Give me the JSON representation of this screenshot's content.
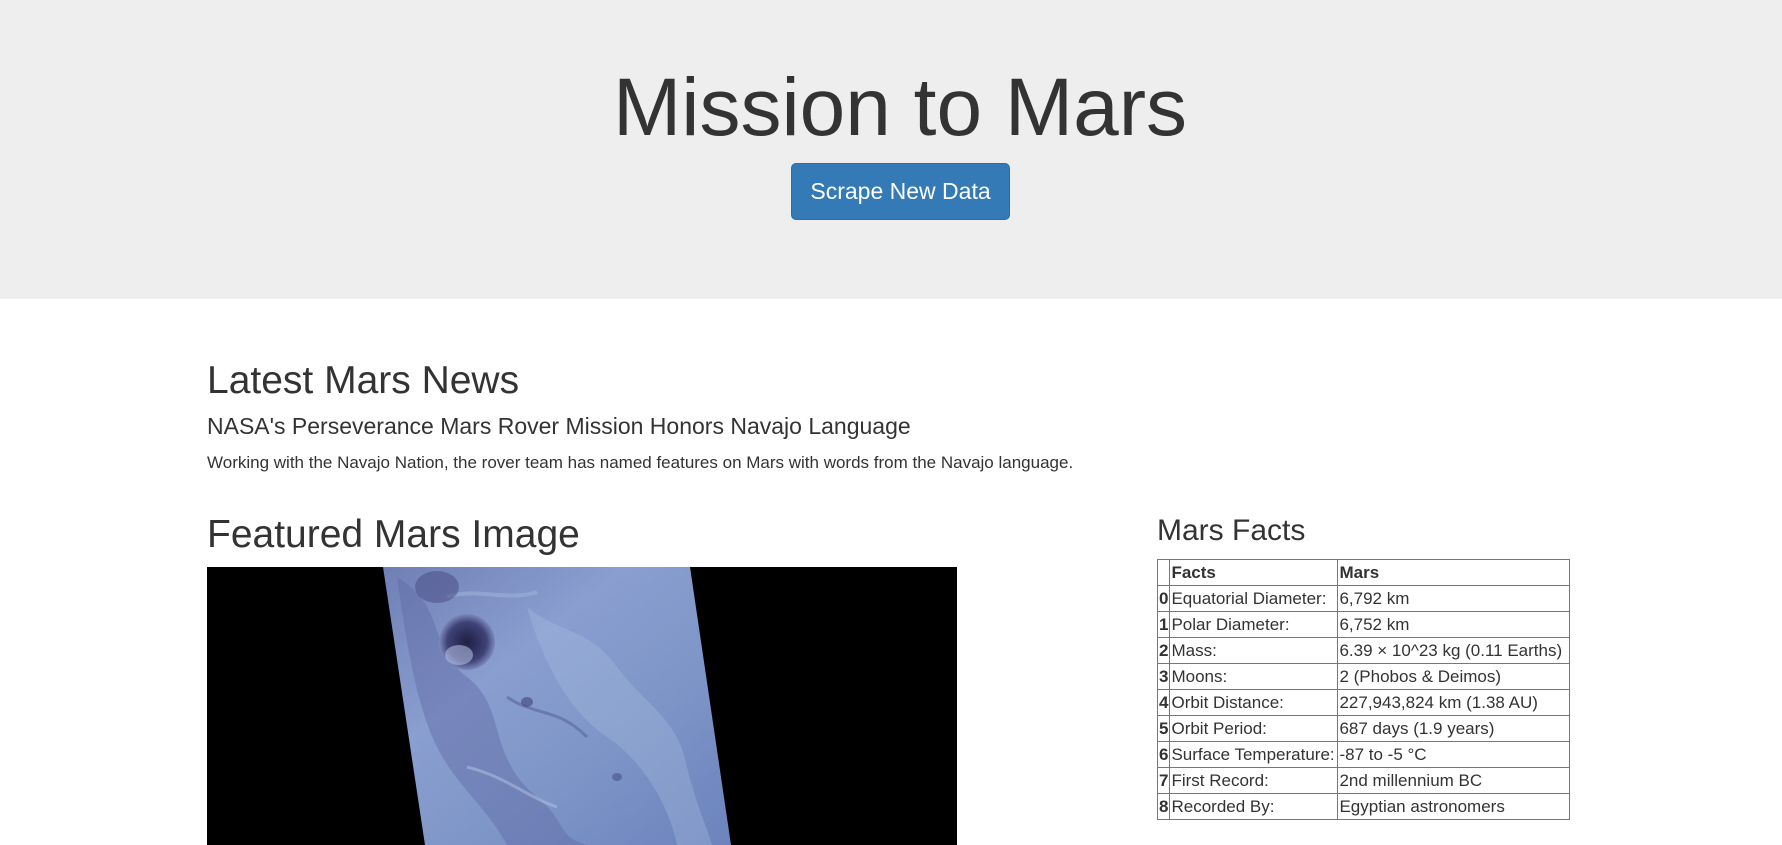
{
  "header": {
    "title": "Mission to Mars",
    "scrape_button_label": "Scrape New Data"
  },
  "news": {
    "section_heading": "Latest Mars News",
    "title": "NASA's Perseverance Mars Rover Mission Honors Navajo Language",
    "paragraph": "Working with the Navajo Nation, the rover team has named features on Mars with words from the Navajo language."
  },
  "featured_image": {
    "section_heading": "Featured Mars Image"
  },
  "facts": {
    "section_heading": "Mars Facts",
    "columns": [
      "",
      "Facts",
      "Mars"
    ],
    "rows": [
      {
        "index": "0",
        "fact": "Equatorial Diameter:",
        "mars": "6,792 km"
      },
      {
        "index": "1",
        "fact": "Polar Diameter:",
        "mars": "6,752 km"
      },
      {
        "index": "2",
        "fact": "Mass:",
        "mars": "6.39 × 10^23 kg (0.11 Earths)"
      },
      {
        "index": "3",
        "fact": "Moons:",
        "mars": "2 (Phobos & Deimos)"
      },
      {
        "index": "4",
        "fact": "Orbit Distance:",
        "mars": "227,943,824 km (1.38 AU)"
      },
      {
        "index": "5",
        "fact": "Orbit Period:",
        "mars": "687 days (1.9 years)"
      },
      {
        "index": "6",
        "fact": "Surface Temperature:",
        "mars": "-87 to -5 °C"
      },
      {
        "index": "7",
        "fact": "First Record:",
        "mars": "2nd millennium BC"
      },
      {
        "index": "8",
        "fact": "Recorded By:",
        "mars": "Egyptian astronomers"
      }
    ]
  },
  "colors": {
    "jumbotron_bg": "#eeeeee",
    "button_primary": "#337ab7",
    "text": "#333333"
  }
}
